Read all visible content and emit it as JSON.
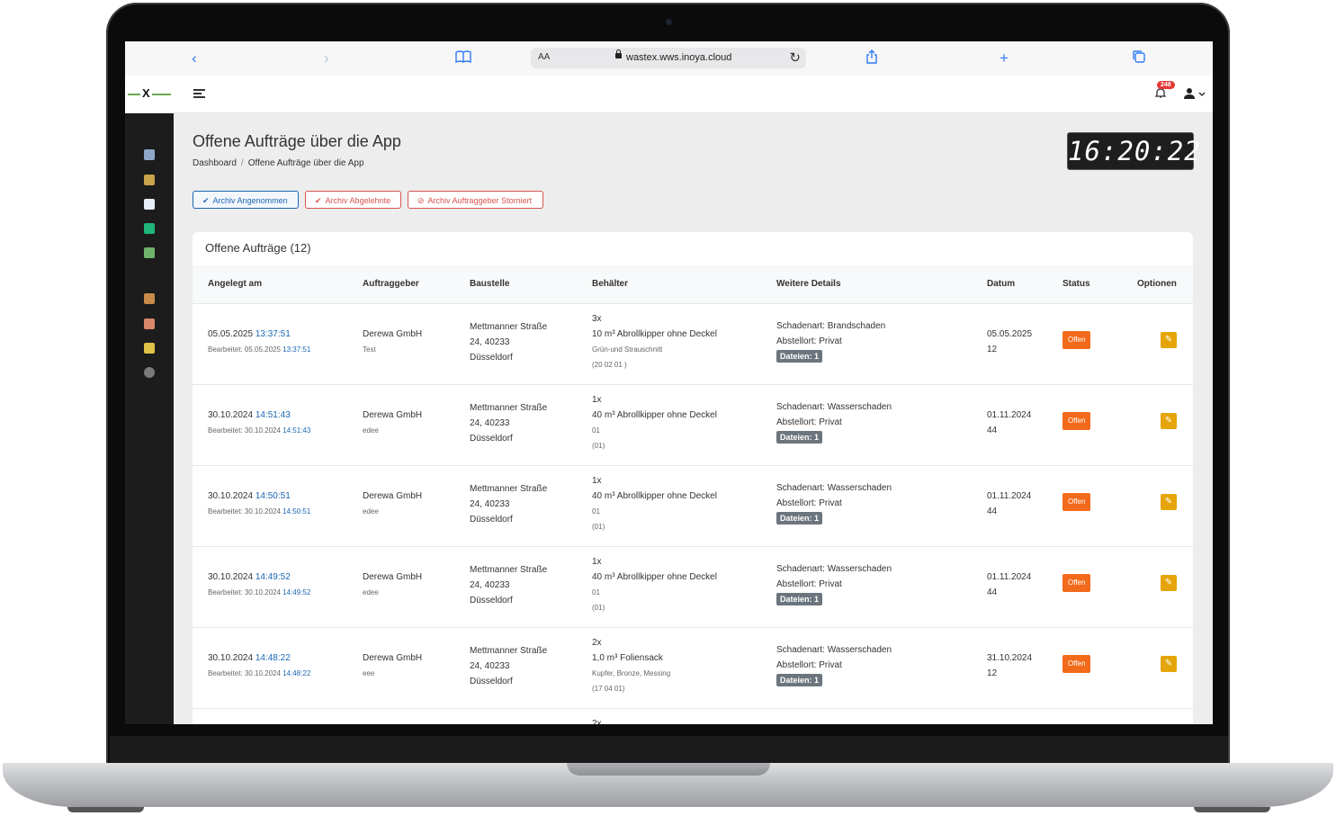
{
  "browser": {
    "url": "wastex.wws.inoya.cloud",
    "aa_label": "AA"
  },
  "header": {
    "notification_count": "248"
  },
  "page": {
    "title": "Offene Aufträge über die App",
    "breadcrumb": [
      "Dashboard",
      "Offene Aufträge über die App"
    ],
    "clock": "16:20:22"
  },
  "filters": [
    {
      "label": "Archiv Angenommen",
      "icon": "check-icon"
    },
    {
      "label": "Archiv Abgelehnte",
      "icon": "check-icon"
    },
    {
      "label": "Archiv Auftraggeber Storniert",
      "icon": "ban-icon"
    }
  ],
  "table": {
    "title": "Offene Aufträge (12)",
    "columns": [
      "Angelegt am",
      "Auftraggeber",
      "Baustelle",
      "Behälter",
      "Weitere Details",
      "Datum",
      "Status",
      "Optionen"
    ],
    "rows": [
      {
        "date": "05.05.2025",
        "time": "13:37:51",
        "edited_label": "Bearbeitet: 05.05.2025",
        "edited_time": "13:37:51",
        "client": "Derewa GmbH",
        "client_sub": "Test",
        "site": [
          "Mettmanner Straße",
          "24, 40233",
          "Düsseldorf"
        ],
        "qty": "3x",
        "container": "10 m³ Abrollkipper ohne Deckel",
        "material": "Grün-und Strauschnitt",
        "code": "(20 02 01 )",
        "damage": "Schadenart: Brandschaden",
        "location": "Abstellort: Privat",
        "files": "Dateien: 1",
        "datum": "05.05.2025",
        "datum_sub": "12",
        "status": "Offen"
      },
      {
        "date": "30.10.2024",
        "time": "14:51:43",
        "edited_label": "Bearbeitet: 30.10.2024",
        "edited_time": "14:51:43",
        "client": "Derewa GmbH",
        "client_sub": "edee",
        "site": [
          "Mettmanner Straße",
          "24, 40233",
          "Düsseldorf"
        ],
        "qty": "1x",
        "container": "40 m³ Abrollkipper ohne Deckel",
        "material": "01",
        "code": "(01)",
        "damage": "Schadenart: Wasserschaden",
        "location": "Abstellort: Privat",
        "files": "Dateien: 1",
        "datum": "01.11.2024",
        "datum_sub": "44",
        "status": "Offen"
      },
      {
        "date": "30.10.2024",
        "time": "14:50:51",
        "edited_label": "Bearbeitet: 30.10.2024",
        "edited_time": "14:50:51",
        "client": "Derewa GmbH",
        "client_sub": "edee",
        "site": [
          "Mettmanner Straße",
          "24, 40233",
          "Düsseldorf"
        ],
        "qty": "1x",
        "container": "40 m³ Abrollkipper ohne Deckel",
        "material": "01",
        "code": "(01)",
        "damage": "Schadenart: Wasserschaden",
        "location": "Abstellort: Privat",
        "files": "Dateien: 1",
        "datum": "01.11.2024",
        "datum_sub": "44",
        "status": "Offen"
      },
      {
        "date": "30.10.2024",
        "time": "14:49:52",
        "edited_label": "Bearbeitet: 30.10.2024",
        "edited_time": "14:49:52",
        "client": "Derewa GmbH",
        "client_sub": "edee",
        "site": [
          "Mettmanner Straße",
          "24, 40233",
          "Düsseldorf"
        ],
        "qty": "1x",
        "container": "40 m³ Abrollkipper ohne Deckel",
        "material": "01",
        "code": "(01)",
        "damage": "Schadenart: Wasserschaden",
        "location": "Abstellort: Privat",
        "files": "Dateien: 1",
        "datum": "01.11.2024",
        "datum_sub": "44",
        "status": "Offen"
      },
      {
        "date": "30.10.2024",
        "time": "14:48:22",
        "edited_label": "Bearbeitet: 30.10.2024",
        "edited_time": "14:48:22",
        "client": "Derewa GmbH",
        "client_sub": "eee",
        "site": [
          "Mettmanner Straße",
          "24, 40233",
          "Düsseldorf"
        ],
        "qty": "2x",
        "container": "1,0 m³ Foliensack",
        "material": "Kupfer, Bronze, Messing",
        "code": "(17 04 01)",
        "damage": "Schadenart: Wasserschaden",
        "location": "Abstellort: Privat",
        "files": "Dateien: 1",
        "datum": "31.10.2024",
        "datum_sub": "12",
        "status": "Offen"
      }
    ],
    "partial_row": {
      "qty": "2x"
    }
  },
  "colors": {
    "status_offen": "#f26a1b",
    "edit_button": "#e5a50a",
    "link": "#1b66b3",
    "danger": "#d9534f"
  }
}
